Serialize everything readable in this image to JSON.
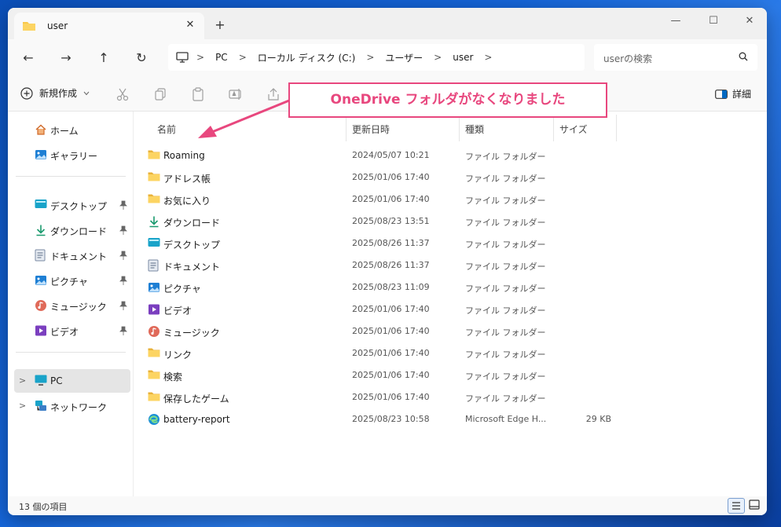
{
  "tab": {
    "title": "user",
    "close": "✕",
    "new": "+"
  },
  "window_controls": {
    "minimize": "—",
    "maximize": "☐",
    "close": "✕"
  },
  "nav": {
    "back": "←",
    "forward": "→",
    "up": "↑",
    "refresh": "↻"
  },
  "breadcrumb": [
    "PC",
    "ローカル ディスク (C:)",
    "ユーザー",
    "user"
  ],
  "breadcrumb_sep": ">",
  "search": {
    "placeholder": "userの検索"
  },
  "toolbar": {
    "new_label": "新規作成",
    "details_label": "詳細"
  },
  "sidebar": {
    "home": "ホーム",
    "gallery": "ギャラリー",
    "quick": [
      {
        "label": "デスクトップ",
        "icon": "desktop-icon"
      },
      {
        "label": "ダウンロード",
        "icon": "download-icon"
      },
      {
        "label": "ドキュメント",
        "icon": "document-icon"
      },
      {
        "label": "ピクチャ",
        "icon": "pictures-icon"
      },
      {
        "label": "ミュージック",
        "icon": "music-icon"
      },
      {
        "label": "ビデオ",
        "icon": "video-icon"
      }
    ],
    "pc": "PC",
    "network": "ネットワーク"
  },
  "columns": {
    "name": "名前",
    "date": "更新日時",
    "type": "種類",
    "size": "サイズ"
  },
  "files": [
    {
      "name": "Roaming",
      "date": "2024/05/07 10:21",
      "type": "ファイル フォルダー",
      "size": "",
      "icon": "folder"
    },
    {
      "name": "アドレス帳",
      "date": "2025/01/06 17:40",
      "type": "ファイル フォルダー",
      "size": "",
      "icon": "folder"
    },
    {
      "name": "お気に入り",
      "date": "2025/01/06 17:40",
      "type": "ファイル フォルダー",
      "size": "",
      "icon": "folder"
    },
    {
      "name": "ダウンロード",
      "date": "2025/08/23 13:51",
      "type": "ファイル フォルダー",
      "size": "",
      "icon": "download"
    },
    {
      "name": "デスクトップ",
      "date": "2025/08/26 11:37",
      "type": "ファイル フォルダー",
      "size": "",
      "icon": "desktop"
    },
    {
      "name": "ドキュメント",
      "date": "2025/08/26 11:37",
      "type": "ファイル フォルダー",
      "size": "",
      "icon": "document"
    },
    {
      "name": "ピクチャ",
      "date": "2025/08/23 11:09",
      "type": "ファイル フォルダー",
      "size": "",
      "icon": "pictures"
    },
    {
      "name": "ビデオ",
      "date": "2025/01/06 17:40",
      "type": "ファイル フォルダー",
      "size": "",
      "icon": "video"
    },
    {
      "name": "ミュージック",
      "date": "2025/01/06 17:40",
      "type": "ファイル フォルダー",
      "size": "",
      "icon": "music"
    },
    {
      "name": "リンク",
      "date": "2025/01/06 17:40",
      "type": "ファイル フォルダー",
      "size": "",
      "icon": "folder"
    },
    {
      "name": "検索",
      "date": "2025/01/06 17:40",
      "type": "ファイル フォルダー",
      "size": "",
      "icon": "folder"
    },
    {
      "name": "保存したゲーム",
      "date": "2025/01/06 17:40",
      "type": "ファイル フォルダー",
      "size": "",
      "icon": "folder"
    },
    {
      "name": "battery-report",
      "date": "2025/08/23 10:58",
      "type": "Microsoft Edge H...",
      "size": "29 KB",
      "icon": "edge"
    }
  ],
  "status": {
    "count": "13 個の項目"
  },
  "annotation": {
    "text": "OneDrive フォルダがなくなりました"
  },
  "colors": {
    "accent": "#0067c0",
    "annotation": "#e8477e",
    "folder": "#f8c84a"
  }
}
